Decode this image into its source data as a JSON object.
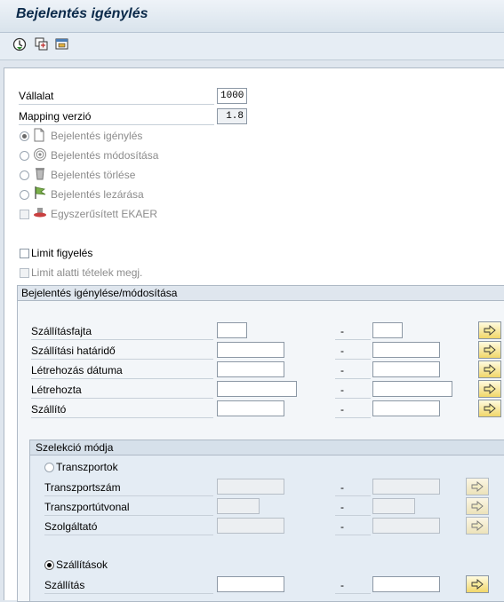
{
  "title": "Bejelentés igénylés",
  "toolbar": {
    "icons": [
      "execute-icon",
      "copy-icon",
      "layout-icon"
    ]
  },
  "header": {
    "company_label": "Vállalat",
    "company_value": "1000",
    "mapping_label": "Mapping verzió",
    "mapping_value": "1.8"
  },
  "actions": {
    "request": "Bejelentés igénylés",
    "modify": "Bejelentés módosítása",
    "delete": "Bejelentés törlése",
    "close": "Bejelentés lezárása",
    "simplified": "Egyszerűsített EKAER"
  },
  "limits": {
    "limit_label": "Limit figyelés",
    "below_label": "Limit alatti tételek megj."
  },
  "group_main": {
    "title": "Bejelentés igénylése/módosítása",
    "fields": {
      "shipping_type": "Szállításfajta",
      "deadline": "Szállítási határidő",
      "created_date": "Létrehozás dátuma",
      "created_by": "Létrehozta",
      "vendor": "Szállító"
    },
    "dash": "-"
  },
  "group_selection": {
    "title": "Szelekció módja",
    "transports_label": "Transzportok",
    "transport_number": "Transzportszám",
    "transport_route": "Transzportútvonal",
    "service_provider": "Szolgáltató",
    "shipments_label": "Szállítások",
    "shipment": "Szállítás"
  }
}
